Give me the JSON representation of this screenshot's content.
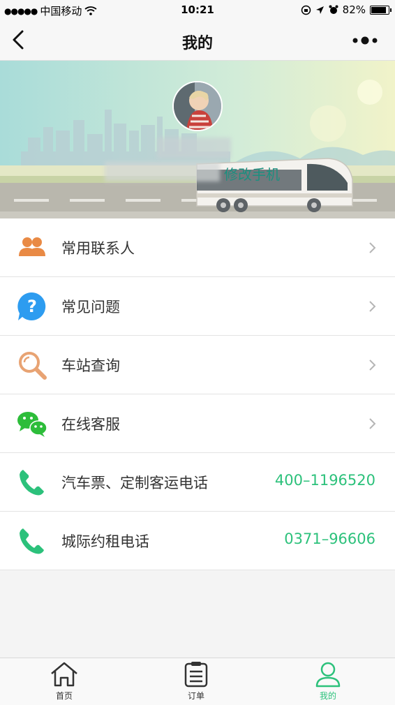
{
  "status": {
    "carrier": "中国移动",
    "time": "10:21",
    "battery": "82%",
    "battery_level": 0.82
  },
  "nav": {
    "title": "我的"
  },
  "profile": {
    "edit_phone": "修改手机"
  },
  "menu": [
    {
      "label": "常用联系人",
      "icon": "contacts-icon"
    },
    {
      "label": "常见问题",
      "icon": "question-icon"
    },
    {
      "label": "车站查询",
      "icon": "search-icon"
    },
    {
      "label": "在线客服",
      "icon": "wechat-icon"
    },
    {
      "label": "汽车票、定制客运电话",
      "icon": "phone-icon",
      "value": "400–1196520"
    },
    {
      "label": "城际约租电话",
      "icon": "phone-icon",
      "value": "0371–96606"
    }
  ],
  "tabs": [
    {
      "label": "首页",
      "icon": "home-icon"
    },
    {
      "label": "订单",
      "icon": "clipboard-icon"
    },
    {
      "label": "我的",
      "icon": "user-icon",
      "active": true
    }
  ],
  "colors": {
    "accent": "#2cc17b",
    "edit_phone": "#1d8f7f",
    "contacts_icon": "#e98a45",
    "question_icon": "#2d9cf0",
    "search_icon": "#e8a373",
    "wechat_icon": "#2dbd3a"
  }
}
